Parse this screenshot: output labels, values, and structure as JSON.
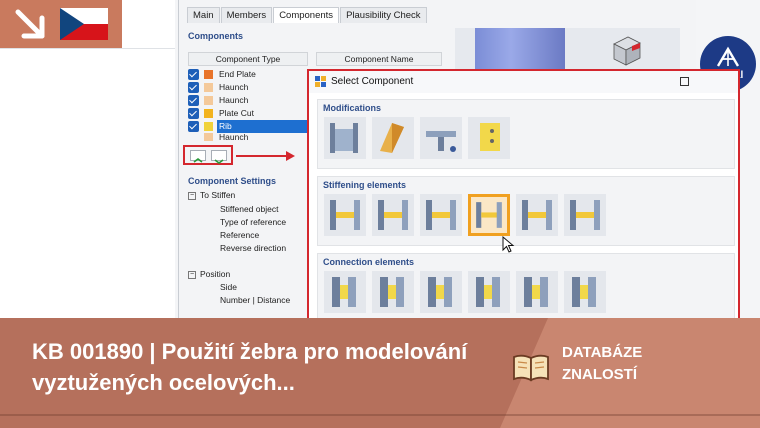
{
  "badge": {
    "flag_colors": [
      "#ffffff",
      "#d7141a",
      "#11457e"
    ]
  },
  "tabs": [
    {
      "label": "Main"
    },
    {
      "label": "Members"
    },
    {
      "label": "Components"
    },
    {
      "label": "Plausibility Check"
    }
  ],
  "components_section": {
    "title": "Components",
    "col_type": "Component Type",
    "col_name": "Component Name",
    "rows": [
      {
        "label": "End Plate",
        "color": "#e8742a",
        "checked": true,
        "selected": false
      },
      {
        "label": "Haunch",
        "color": "#f4c99a",
        "checked": true,
        "selected": false
      },
      {
        "label": "Haunch",
        "color": "#f4c99a",
        "checked": true,
        "selected": false
      },
      {
        "label": "Plate Cut",
        "color": "#f2b31e",
        "checked": true,
        "selected": false
      },
      {
        "label": "Rib",
        "color": "#f0d23a",
        "checked": true,
        "selected": true
      },
      {
        "label": "Haunch",
        "color": "#f4c99a",
        "checked": false,
        "selected": false
      }
    ]
  },
  "settings_section": {
    "title": "Component Settings",
    "group1": "To Stiffen",
    "group1_items": [
      "Stiffened object",
      "Type of reference",
      "Reference",
      "Reverse direction"
    ],
    "group2": "Position",
    "group2_items": [
      "Side",
      "Number | Distance"
    ]
  },
  "logo": {
    "name": "Dlubal"
  },
  "dialog": {
    "title": "Select Component",
    "groups": [
      {
        "title": "Modifications",
        "tile_count": 4,
        "selected": -1
      },
      {
        "title": "Stiffening elements",
        "tile_count": 6,
        "selected": 3
      },
      {
        "title": "Connection elements",
        "tile_count": 6,
        "selected": -1
      }
    ]
  },
  "banner": {
    "title": "KB 001890 | Použití žebra pro modelování vyztužených ocelových...",
    "kb_label_line1": "DATABÁZE",
    "kb_label_line2": "ZNALOSTÍ"
  },
  "colors": {
    "accent_red": "#d4272e",
    "banner": "#b5705c",
    "selection_blue": "#1e6fd0",
    "highlight_orange": "#f0a020"
  }
}
